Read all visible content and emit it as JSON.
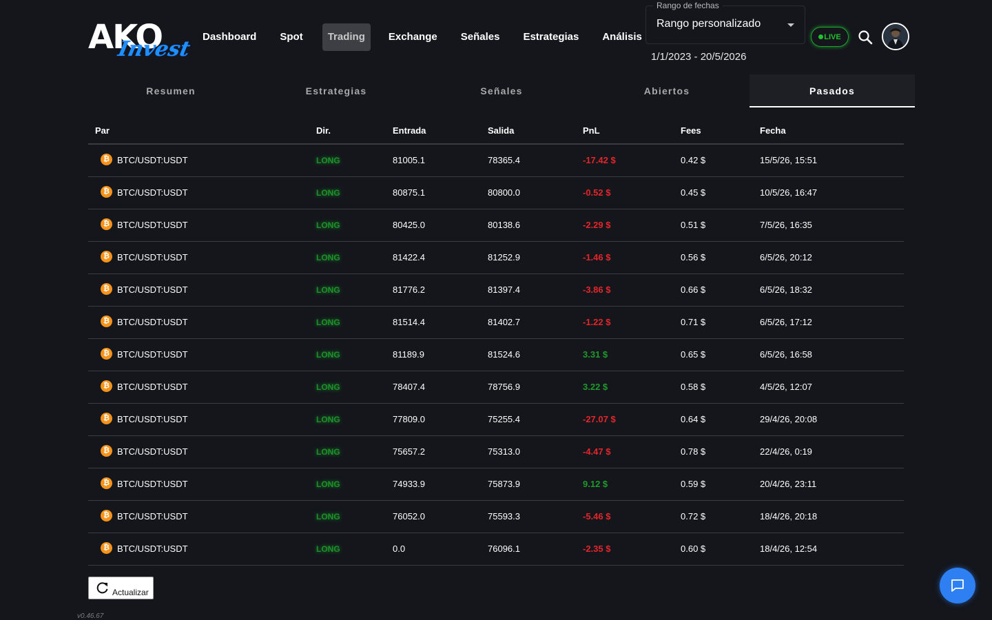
{
  "brand": {
    "name_main": "AKO",
    "name_script": "Invest"
  },
  "nav": {
    "items": [
      {
        "label": "Dashboard",
        "active": false
      },
      {
        "label": "Spot",
        "active": false
      },
      {
        "label": "Trading",
        "active": true
      },
      {
        "label": "Exchange",
        "active": false
      },
      {
        "label": "Señales",
        "active": false
      },
      {
        "label": "Estrategias",
        "active": false
      },
      {
        "label": "Análisis",
        "active": false
      }
    ]
  },
  "date_range": {
    "label": "Rango de fechas",
    "selected": "Rango personalizado",
    "text": "1/1/2023 - 20/5/2026"
  },
  "live": {
    "label": "LIVE",
    "color": "#22c02e"
  },
  "icons": {
    "search": "search-icon",
    "avatar": "user-avatar",
    "chat": "chat-icon",
    "refresh": "refresh-icon",
    "coin": "bitcoin-icon"
  },
  "tabs": [
    {
      "label": "Resumen",
      "active": false
    },
    {
      "label": "Estrategias",
      "active": false
    },
    {
      "label": "Señales",
      "active": false
    },
    {
      "label": "Abiertos",
      "active": false
    },
    {
      "label": "Pasados",
      "active": true
    }
  ],
  "table": {
    "headers": {
      "par": "Par",
      "dir": "Dir.",
      "entrada": "Entrada",
      "salida": "Salida",
      "pnl": "PnL",
      "fees": "Fees",
      "fecha": "Fecha"
    },
    "rows": [
      {
        "par": "BTC/USDT:USDT",
        "dir": "LONG",
        "entrada": "81005.1",
        "salida": "78365.4",
        "pnl": "-17.42 $",
        "pnl_sign": "neg",
        "fees": "0.42 $",
        "fecha": "15/5/26, 15:51"
      },
      {
        "par": "BTC/USDT:USDT",
        "dir": "LONG",
        "entrada": "80875.1",
        "salida": "80800.0",
        "pnl": "-0.52 $",
        "pnl_sign": "neg",
        "fees": "0.45 $",
        "fecha": "10/5/26, 16:47"
      },
      {
        "par": "BTC/USDT:USDT",
        "dir": "LONG",
        "entrada": "80425.0",
        "salida": "80138.6",
        "pnl": "-2.29 $",
        "pnl_sign": "neg",
        "fees": "0.51 $",
        "fecha": "7/5/26, 16:35"
      },
      {
        "par": "BTC/USDT:USDT",
        "dir": "LONG",
        "entrada": "81422.4",
        "salida": "81252.9",
        "pnl": "-1.46 $",
        "pnl_sign": "neg",
        "fees": "0.56 $",
        "fecha": "6/5/26, 20:12"
      },
      {
        "par": "BTC/USDT:USDT",
        "dir": "LONG",
        "entrada": "81776.2",
        "salida": "81397.4",
        "pnl": "-3.86 $",
        "pnl_sign": "neg",
        "fees": "0.66 $",
        "fecha": "6/5/26, 18:32"
      },
      {
        "par": "BTC/USDT:USDT",
        "dir": "LONG",
        "entrada": "81514.4",
        "salida": "81402.7",
        "pnl": "-1.22 $",
        "pnl_sign": "neg",
        "fees": "0.71 $",
        "fecha": "6/5/26, 17:12"
      },
      {
        "par": "BTC/USDT:USDT",
        "dir": "LONG",
        "entrada": "81189.9",
        "salida": "81524.6",
        "pnl": "3.31 $",
        "pnl_sign": "pos",
        "fees": "0.65 $",
        "fecha": "6/5/26, 16:58"
      },
      {
        "par": "BTC/USDT:USDT",
        "dir": "LONG",
        "entrada": "78407.4",
        "salida": "78756.9",
        "pnl": "3.22 $",
        "pnl_sign": "pos",
        "fees": "0.58 $",
        "fecha": "4/5/26, 12:07"
      },
      {
        "par": "BTC/USDT:USDT",
        "dir": "LONG",
        "entrada": "77809.0",
        "salida": "75255.4",
        "pnl": "-27.07 $",
        "pnl_sign": "neg",
        "fees": "0.64 $",
        "fecha": "29/4/26, 20:08"
      },
      {
        "par": "BTC/USDT:USDT",
        "dir": "LONG",
        "entrada": "75657.2",
        "salida": "75313.0",
        "pnl": "-4.47 $",
        "pnl_sign": "neg",
        "fees": "0.78 $",
        "fecha": "22/4/26, 0:19"
      },
      {
        "par": "BTC/USDT:USDT",
        "dir": "LONG",
        "entrada": "74933.9",
        "salida": "75873.9",
        "pnl": "9.12 $",
        "pnl_sign": "pos",
        "fees": "0.59 $",
        "fecha": "20/4/26, 23:11"
      },
      {
        "par": "BTC/USDT:USDT",
        "dir": "LONG",
        "entrada": "76052.0",
        "salida": "75593.3",
        "pnl": "-5.46 $",
        "pnl_sign": "neg",
        "fees": "0.72 $",
        "fecha": "18/4/26, 20:18"
      },
      {
        "par": "BTC/USDT:USDT",
        "dir": "LONG",
        "entrada": "0.0",
        "salida": "76096.1",
        "pnl": "-2.35 $",
        "pnl_sign": "neg",
        "fees": "0.60 $",
        "fecha": "18/4/26, 12:54"
      }
    ]
  },
  "refresh_label": "Actualizar",
  "version": "v0.46.67",
  "colors": {
    "background": "#14161c",
    "positive": "#1f9a2b",
    "negative": "#e3262b",
    "long": "#1e8f2a",
    "accent": "#2d7ff2"
  }
}
